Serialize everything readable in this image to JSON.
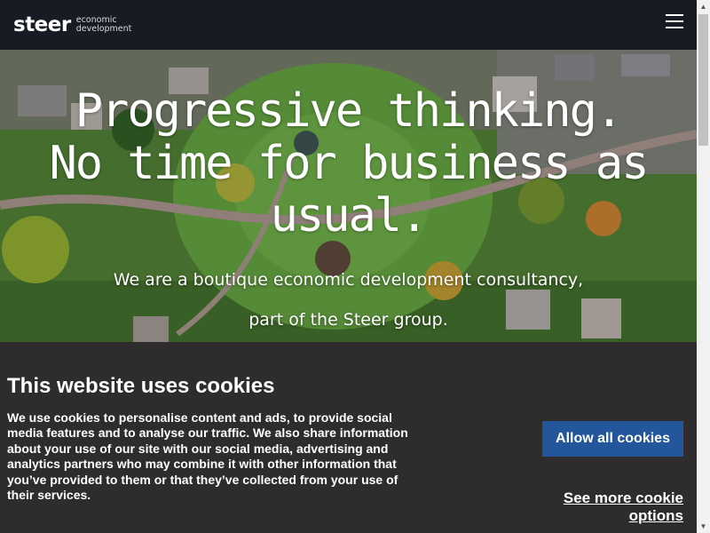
{
  "header": {
    "logo_word": "steer",
    "logo_line1": "economic",
    "logo_line2": "development",
    "menu_icon": "hamburger-menu-icon"
  },
  "hero": {
    "title_line1": "Progressive thinking.",
    "title_line2": "No time for business as",
    "title_line3": "usual.",
    "subtitle_line1": "We are a boutique economic development consultancy,",
    "subtitle_line2": "part of the Steer group."
  },
  "cookie_banner": {
    "title": "This website uses cookies",
    "body": "We use cookies to personalise content and ads, to provide social media features and to analyse our traffic. We also share information about your use of our site with our social media, advertising and analytics partners who may combine it with other information that you’ve provided to them or that they’ve collected from your use of their services.",
    "allow_label": "Allow all cookies",
    "more_label": "See more cookie options"
  },
  "colors": {
    "header_bg": "#171b23",
    "cookie_bg": "#2e2c2d",
    "button_bg": "#23569b"
  }
}
